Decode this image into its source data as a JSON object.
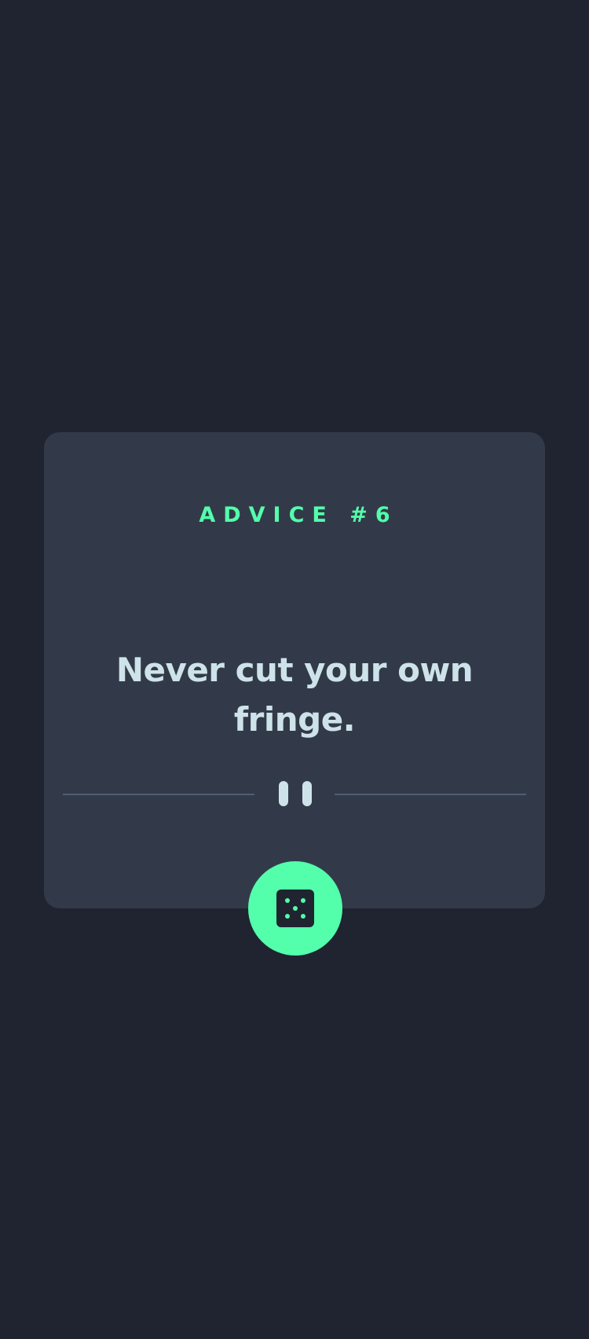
{
  "advice": {
    "label": "ADVICE #6",
    "text": "Never cut your own fringe."
  },
  "divider": {
    "icon": "pause-icon"
  },
  "generate_button": {
    "icon": "dice-icon"
  },
  "colors": {
    "background": "#1f2430",
    "card": "#323a49",
    "accent": "#53ffab",
    "text": "#cee3e9",
    "divider": "#4f5d74"
  }
}
